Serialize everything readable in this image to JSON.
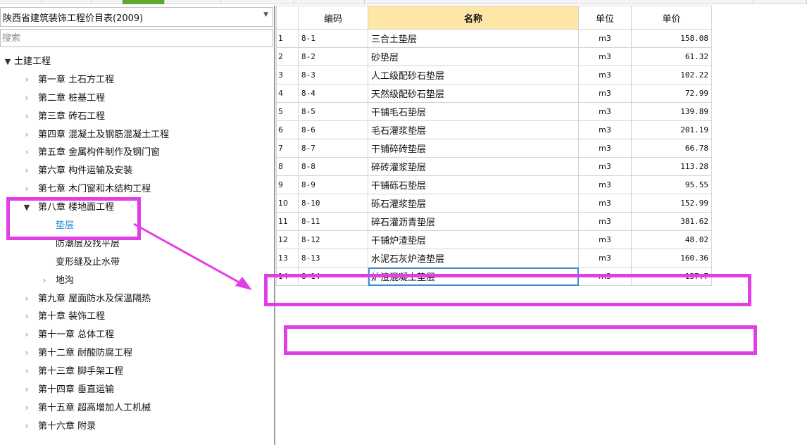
{
  "catalog": {
    "selected": "陕西省建筑装饰工程价目表(2009)"
  },
  "search": {
    "placeholder": "搜索"
  },
  "tree": [
    {
      "label": "土建工程",
      "level": 0,
      "state": "expanded"
    },
    {
      "label": "第一章 土石方工程",
      "level": 1,
      "state": "collapsed"
    },
    {
      "label": "第二章 桩基工程",
      "level": 1,
      "state": "collapsed"
    },
    {
      "label": "第三章 砖石工程",
      "level": 1,
      "state": "collapsed"
    },
    {
      "label": "第四章 混凝土及钢筋混凝土工程",
      "level": 1,
      "state": "collapsed"
    },
    {
      "label": "第五章 金属构件制作及钢门窗",
      "level": 1,
      "state": "collapsed"
    },
    {
      "label": "第六章 构件运输及安装",
      "level": 1,
      "state": "collapsed"
    },
    {
      "label": "第七章 木门窗和木结构工程",
      "level": 1,
      "state": "collapsed"
    },
    {
      "label": "第八章 楼地面工程",
      "level": 1,
      "state": "expanded"
    },
    {
      "label": "垫层",
      "level": 2,
      "state": "leaf",
      "selected": true
    },
    {
      "label": "防潮层及找平层",
      "level": 2,
      "state": "leaf"
    },
    {
      "label": "变形缝及止水带",
      "level": 2,
      "state": "leaf"
    },
    {
      "label": "地沟",
      "level": 2,
      "state": "collapsed"
    },
    {
      "label": "第九章 屋面防水及保温隔热",
      "level": 1,
      "state": "collapsed"
    },
    {
      "label": "第十章 装饰工程",
      "level": 1,
      "state": "collapsed"
    },
    {
      "label": "第十一章 总体工程",
      "level": 1,
      "state": "collapsed"
    },
    {
      "label": "第十二章 耐酸防腐工程",
      "level": 1,
      "state": "collapsed"
    },
    {
      "label": "第十三章 脚手架工程",
      "level": 1,
      "state": "collapsed"
    },
    {
      "label": "第十四章 垂直运输",
      "level": 1,
      "state": "collapsed"
    },
    {
      "label": "第十五章 超高增加人工机械",
      "level": 1,
      "state": "collapsed"
    },
    {
      "label": "第十六章 附录",
      "level": 1,
      "state": "collapsed"
    }
  ],
  "grid": {
    "headers": {
      "code": "编码",
      "name": "名称",
      "unit": "单位",
      "price": "单价"
    },
    "rows": [
      {
        "num": "1",
        "code": "8-1",
        "name": "三合土垫层",
        "unit": "m3",
        "price": "158.08"
      },
      {
        "num": "2",
        "code": "8-2",
        "name": "砂垫层",
        "unit": "m3",
        "price": "61.32"
      },
      {
        "num": "3",
        "code": "8-3",
        "name": "人工级配砂石垫层",
        "unit": "m3",
        "price": "102.22"
      },
      {
        "num": "4",
        "code": "8-4",
        "name": "天然级配砂石垫层",
        "unit": "m3",
        "price": "72.99"
      },
      {
        "num": "5",
        "code": "8-5",
        "name": "干铺毛石垫层",
        "unit": "m3",
        "price": "139.89"
      },
      {
        "num": "6",
        "code": "8-6",
        "name": "毛石灌浆垫层",
        "unit": "m3",
        "price": "201.19"
      },
      {
        "num": "7",
        "code": "8-7",
        "name": "干铺碎砖垫层",
        "unit": "m3",
        "price": "66.78"
      },
      {
        "num": "8",
        "code": "8-8",
        "name": "碎砖灌浆垫层",
        "unit": "m3",
        "price": "113.28"
      },
      {
        "num": "9",
        "code": "8-9",
        "name": "干铺砾石垫层",
        "unit": "m3",
        "price": "95.55"
      },
      {
        "num": "10",
        "code": "8-10",
        "name": "砾石灌浆垫层",
        "unit": "m3",
        "price": "152.99"
      },
      {
        "num": "11",
        "code": "8-11",
        "name": "碎石灌沥青垫层",
        "unit": "m3",
        "price": "381.62"
      },
      {
        "num": "12",
        "code": "8-12",
        "name": "干铺炉渣垫层",
        "unit": "m3",
        "price": "48.02"
      },
      {
        "num": "13",
        "code": "8-13",
        "name": "水泥石灰炉渣垫层",
        "unit": "m3",
        "price": "160.36"
      },
      {
        "num": "14",
        "code": "8-14",
        "name": "炉渣混凝土垫层",
        "unit": "m3",
        "price": "157.7"
      }
    ]
  },
  "annotation": {
    "color": "#e23ee6"
  }
}
